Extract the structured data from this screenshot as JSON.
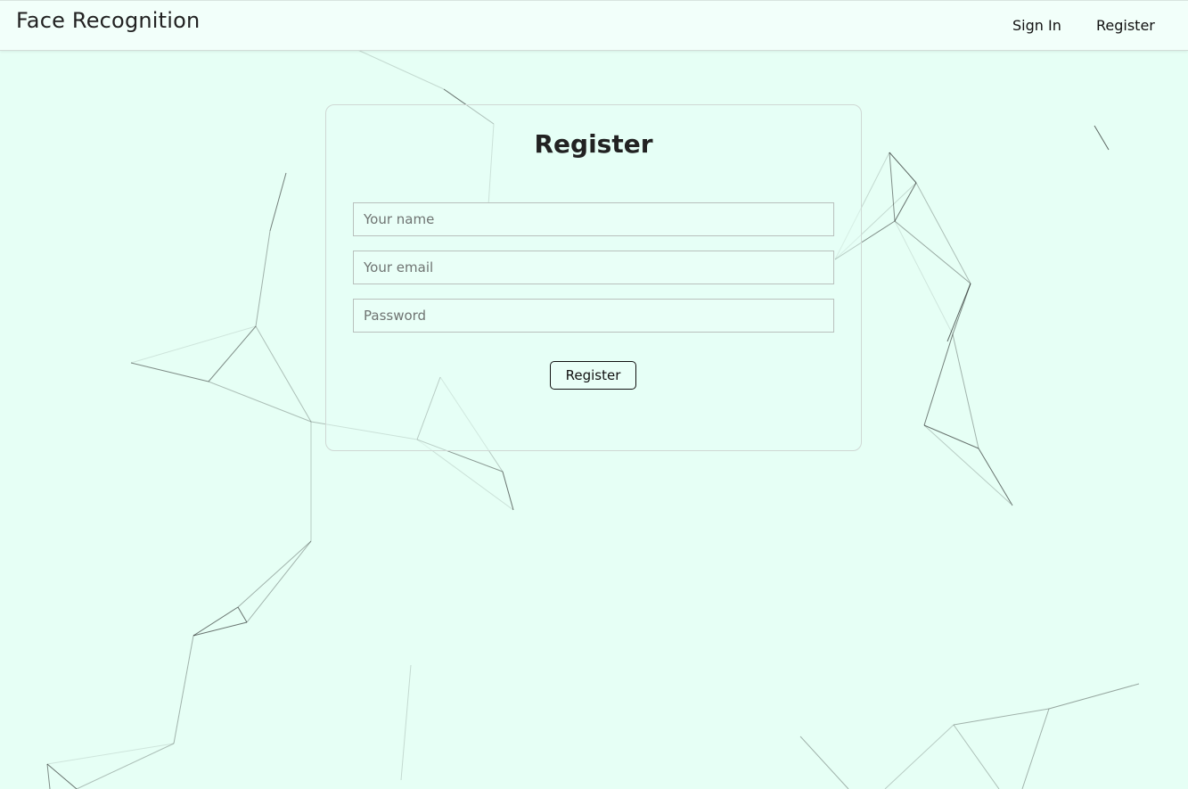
{
  "navbar": {
    "brand": "Face Recognition",
    "links": [
      {
        "label": "Sign In"
      },
      {
        "label": "Register"
      }
    ]
  },
  "form": {
    "title": "Register",
    "name_placeholder": "Your name",
    "email_placeholder": "Your email",
    "password_placeholder": "Password",
    "submit_label": "Register"
  },
  "colors": {
    "background": "#e6fff5",
    "navbar": "#f2fffa",
    "particle_line": "#000000"
  }
}
